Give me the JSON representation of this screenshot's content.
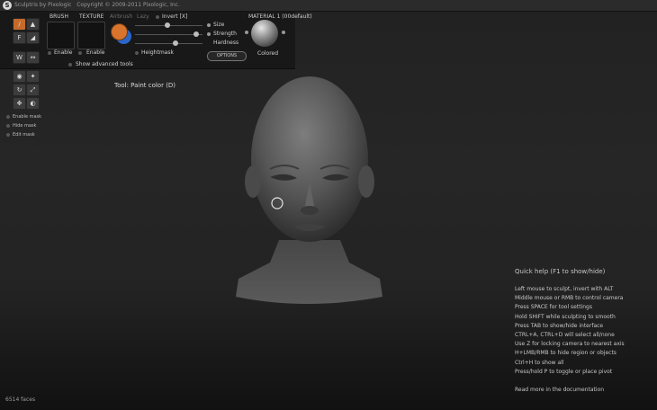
{
  "titlebar": {
    "app_title": "Sculptris by Pixologic",
    "copyright": "Copyright © 2009-2011 Pixologic, Inc.",
    "logo_letter": "S"
  },
  "toolbar": {
    "brush_label": "BRUSH",
    "texture_label": "TEXTURE",
    "airbrush_label": "Airbrush",
    "lazy_label": "Lazy",
    "invert_label": "Invert [X]",
    "size_label": "Size",
    "strength_label": "Strength",
    "hardness_label": "Hardness",
    "heightmask_label": "Heightmask",
    "brush_enable": "Enable",
    "texture_enable": "Enable",
    "show_advanced": "Show advanced tools",
    "options_button": "OPTIONS",
    "material_label": "MATERIAL 1 (00default)",
    "colored_label": "Colored",
    "size_value": 0.48,
    "strength_value": 0.9,
    "hardness_value": 0.6
  },
  "sidebar": {
    "enable_mask": "Enable mask",
    "hide_mask": "Hide mask",
    "edit_mask": "Edit mask"
  },
  "tool_status": "Tool: Paint color (D)",
  "help": {
    "title": "Quick help (F1 to show/hide)",
    "lines": [
      "Left mouse to sculpt, invert with ALT",
      "Middle mouse or RMB to control camera",
      "Press SPACE for tool settings",
      "Hold SHIFT while sculpting to smooth",
      "Press TAB to show/hide interface",
      "CTRL+A, CTRL+D will select all/none",
      "Use Z for locking camera to nearest axis",
      "H+LMB/RMB to hide region or objects",
      "Ctrl+H to show all",
      "Press/hold P to toggle or place pivot"
    ],
    "doc_link": "Read more in the documentation"
  },
  "footer": {
    "faces": "6514 faces"
  },
  "colors": {
    "primary_paint": "#d9742c",
    "secondary_paint": "#2a66c8"
  }
}
